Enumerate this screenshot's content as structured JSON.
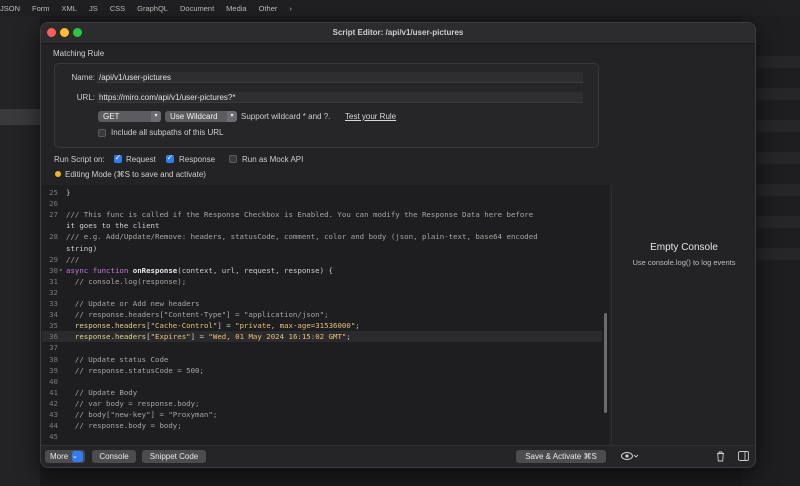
{
  "background_app": {
    "tabs": [
      "JSON",
      "Form",
      "XML",
      "JS",
      "CSS",
      "GraphQL",
      "Document",
      "Media",
      "Other"
    ],
    "more_icon": "chevron-right-icon"
  },
  "window": {
    "title": "Script Editor: /api/v1/user-pictures",
    "traffic_lights": {
      "close": "#ff5f57",
      "minimize": "#febc2e",
      "zoom": "#28c840"
    }
  },
  "matching_rule": {
    "section_title": "Matching Rule",
    "name_label": "Name:",
    "name_value": "/api/v1/user-pictures",
    "url_label": "URL:",
    "url_value": "https://miro.com/api/v1/user-pictures?*",
    "method": "GET",
    "match_mode": "Use Wildcard",
    "wildcard_hint": "Support wildcard * and ?.",
    "test_link": "Test your Rule",
    "include_subpaths_label": "Include all subpaths of this URL",
    "include_subpaths_checked": false
  },
  "run_options": {
    "label": "Run Script on:",
    "request_label": "Request",
    "request_checked": true,
    "response_label": "Response",
    "response_checked": true,
    "mock_label": "Run as Mock API",
    "mock_checked": false
  },
  "status": {
    "text": "Editing Mode (⌘S to save and activate)",
    "color": "#f2b620"
  },
  "editor": {
    "lines": [
      {
        "n": "25",
        "t": "}"
      },
      {
        "n": "26",
        "t": ""
      },
      {
        "n": "27",
        "t": "/// This func is called if the Response Checkbox is Enabled. You can modify the Response Data here before"
      },
      {
        "n": "",
        "t": "it goes to the client"
      },
      {
        "n": "28",
        "t": "/// e.g. Add/Update/Remove: headers, statusCode, comment, color and body (json, plain-text, base64 encoded"
      },
      {
        "n": "",
        "t": "string)"
      },
      {
        "n": "29",
        "t": "///"
      },
      {
        "n": "30",
        "t": "async function onResponse(context, url, request, response) {"
      },
      {
        "n": "31",
        "t": "  // console.log(response);"
      },
      {
        "n": "32",
        "t": ""
      },
      {
        "n": "33",
        "t": "  // Update or Add new headers"
      },
      {
        "n": "34",
        "t": "  // response.headers[\"Content-Type\"] = \"application/json\";"
      },
      {
        "n": "35",
        "t": "  response.headers[\"Cache-Control\"] = \"private, max-age=31536000\";"
      },
      {
        "n": "36",
        "t": "  response.headers[\"Expires\"] = \"Wed, 01 May 2024 16:15:02 GMT\";"
      },
      {
        "n": "37",
        "t": ""
      },
      {
        "n": "38",
        "t": "  // Update status Code"
      },
      {
        "n": "39",
        "t": "  // response.statusCode = 500;"
      },
      {
        "n": "40",
        "t": ""
      },
      {
        "n": "41",
        "t": "  // Update Body"
      },
      {
        "n": "42",
        "t": "  // var body = response.body;"
      },
      {
        "n": "43",
        "t": "  // body[\"new-key\"] = \"Proxyman\";"
      },
      {
        "n": "44",
        "t": "  // response.body = body;"
      },
      {
        "n": "45",
        "t": ""
      }
    ],
    "current_line": "36"
  },
  "console": {
    "title": "Empty Console",
    "subtitle": "Use console.log() to log events"
  },
  "footer": {
    "more_label": "More",
    "console_label": "Console",
    "snippet_label": "Snippet Code",
    "save_label": "Save & Activate ⌘S",
    "eye_icon": "eye-icon",
    "trash_icon": "trash-icon",
    "sidebar_icon": "sidebar-toggle-icon"
  }
}
